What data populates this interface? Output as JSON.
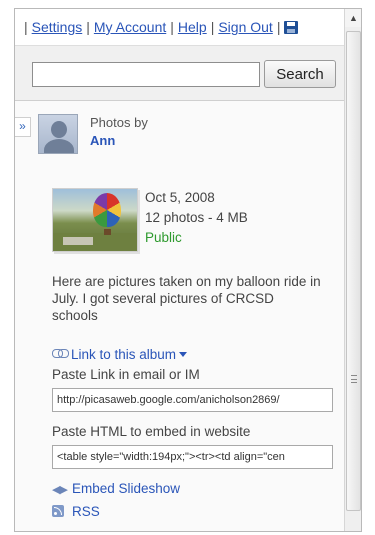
{
  "toplinks": {
    "settings": "Settings",
    "my_account": "My Account",
    "help": "Help",
    "sign_out": "Sign Out",
    "separator": "|"
  },
  "search": {
    "value": "",
    "placeholder": "",
    "button_label": "Search"
  },
  "sidebar": {
    "collapse_glyph": "»",
    "photos_by": "Photos by",
    "owner": "Ann"
  },
  "album": {
    "date": "Oct 5, 2008",
    "count": "12 photos - 4 MB",
    "visibility": "Public",
    "description": "Here are pictures taken on my balloon ride in July. I got several pictures of CRCSD schools"
  },
  "share": {
    "link_to_album": "Link to this album",
    "paste_link_label": "Paste Link in email or IM",
    "paste_link_value": "http://picasaweb.google.com/anicholson2869/",
    "paste_html_label": "Paste HTML to embed in website",
    "paste_html_value": "<table style=\"width:194px;\"><tr><td align=\"cen",
    "embed_slideshow": "Embed Slideshow",
    "rss": "RSS"
  },
  "icons": {
    "link": "chain-link-icon",
    "embed": "embed-icon",
    "rss": "rss-icon",
    "save": "floppy-disk-icon"
  },
  "colors": {
    "link": "#2a55b8",
    "public": "#2e9a2e",
    "search_bar_bg": "#f0f0f0"
  }
}
